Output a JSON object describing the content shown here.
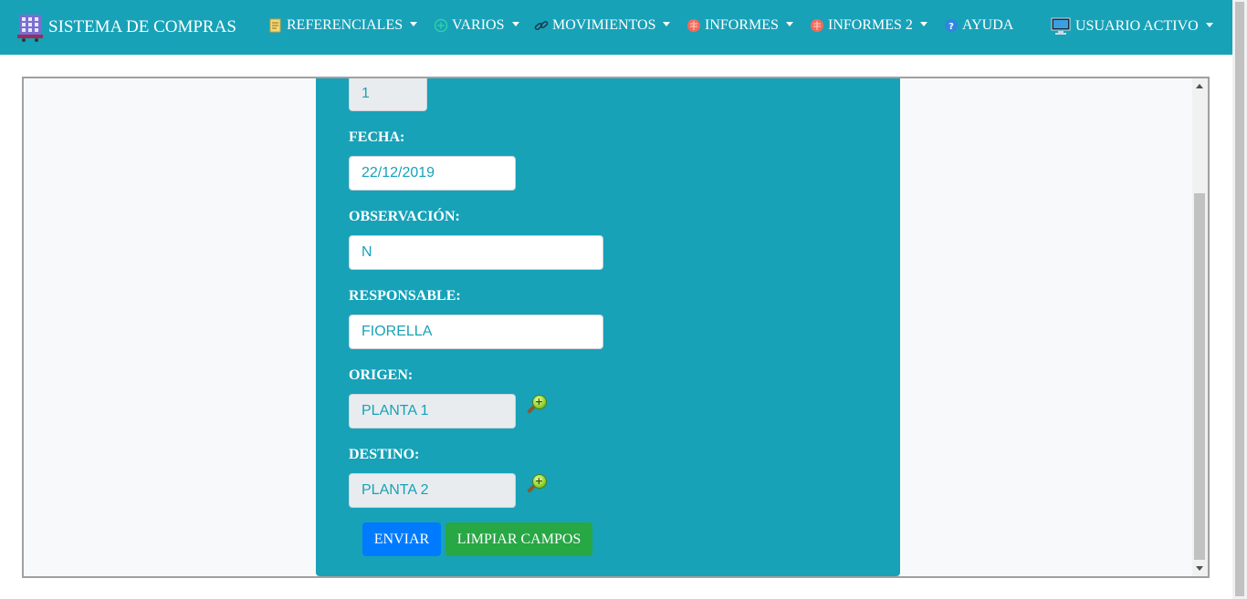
{
  "navbar": {
    "brand": "SISTEMA DE COMPRAS",
    "menus": [
      {
        "label": "REFERENCIALES",
        "icon": "notepad-icon"
      },
      {
        "label": "VARIOS",
        "icon": "plus-circle-icon"
      },
      {
        "label": "MOVIMIENTOS",
        "icon": "link-icon"
      },
      {
        "label": "INFORMES",
        "icon": "report-icon"
      },
      {
        "label": "INFORMES 2",
        "icon": "report-icon"
      },
      {
        "label": "AYUDA",
        "icon": "help-icon"
      },
      {
        "label": "USUARIO ACTIVO",
        "icon": "monitor-icon"
      }
    ]
  },
  "form": {
    "id_value": "1",
    "fecha_label": "FECHA:",
    "fecha_value": "22/12/2019",
    "observacion_label": "OBSERVACIÓN:",
    "observacion_value": "N",
    "responsable_label": "RESPONSABLE:",
    "responsable_value": "FIORELLA",
    "origen_label": "ORIGEN:",
    "origen_value": "PLANTA 1",
    "destino_label": "DESTINO:",
    "destino_value": "PLANTA 2",
    "enviar_label": "ENVIAR",
    "limpiar_label": "LIMPIAR CAMPOS"
  },
  "colors": {
    "navbar": "#17a2b8",
    "panel": "#17a2b8",
    "primary": "#007bff",
    "success": "#28a745"
  }
}
